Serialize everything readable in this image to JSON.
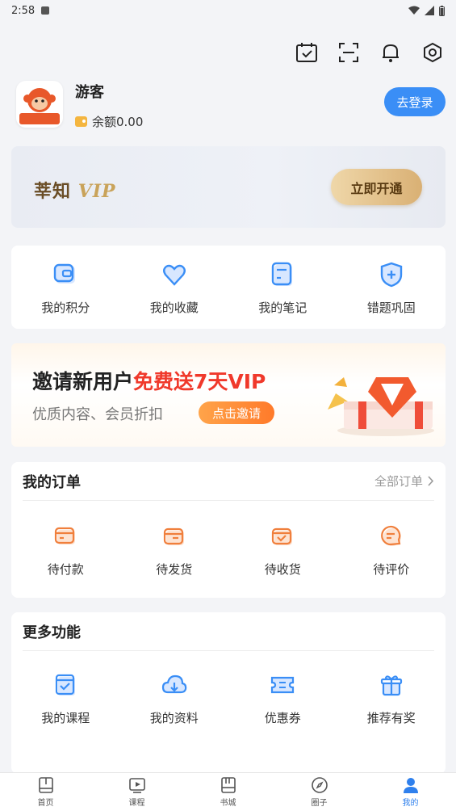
{
  "status": {
    "time": "2:58"
  },
  "profile": {
    "username": "游客",
    "balance": "余额0.00",
    "login_label": "去登录",
    "avatar_text": "莘知公考"
  },
  "vip": {
    "brand": "莘知",
    "vip_word": "VIP",
    "open_label": "立即开通"
  },
  "quick": {
    "items": [
      {
        "label": "我的积分",
        "icon": "points-card-icon"
      },
      {
        "label": "我的收藏",
        "icon": "heart-icon"
      },
      {
        "label": "我的笔记",
        "icon": "notes-icon"
      },
      {
        "label": "错题巩固",
        "icon": "shield-plus-icon"
      }
    ]
  },
  "invite": {
    "title_prefix": "邀请新用户",
    "title_highlight": "免费送7天VIP",
    "subtitle": "优质内容、会员折扣",
    "button": "点击邀请"
  },
  "orders": {
    "title": "我的订单",
    "all_label": "全部订单",
    "items": [
      {
        "label": "待付款",
        "icon": "wallet-pay-icon"
      },
      {
        "label": "待发货",
        "icon": "box-ship-icon"
      },
      {
        "label": "待收货",
        "icon": "box-check-icon"
      },
      {
        "label": "待评价",
        "icon": "chat-review-icon"
      }
    ]
  },
  "more": {
    "title": "更多功能",
    "items": [
      {
        "label": "我的课程",
        "icon": "course-check-icon"
      },
      {
        "label": "我的资料",
        "icon": "cloud-download-icon"
      },
      {
        "label": "优惠券",
        "icon": "coupon-icon"
      },
      {
        "label": "推荐有奖",
        "icon": "gift-icon"
      }
    ]
  },
  "tabbar": {
    "items": [
      {
        "label": "首页",
        "icon": "home-book-icon"
      },
      {
        "label": "课程",
        "icon": "video-play-icon"
      },
      {
        "label": "书城",
        "icon": "bookstore-icon"
      },
      {
        "label": "圈子",
        "icon": "compass-icon"
      },
      {
        "label": "我的",
        "icon": "user-icon"
      }
    ],
    "active": "我的"
  },
  "colors": {
    "accent": "#3a8ef6",
    "order_icon": "#f07f3c",
    "vip_gold": "#d9b074",
    "invite_red": "#f0392b"
  }
}
